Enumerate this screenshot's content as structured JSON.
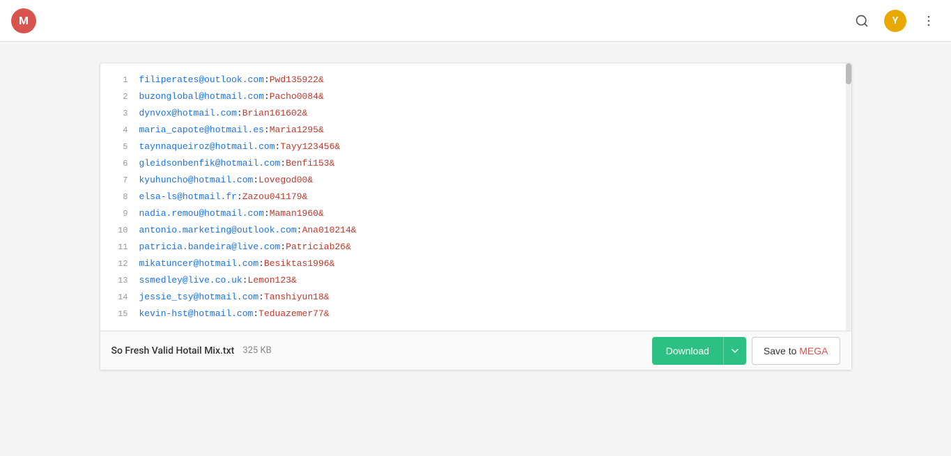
{
  "navbar": {
    "logo_letter": "M",
    "search_icon": "🔍",
    "user_initial": "Y",
    "more_icon": "⋮"
  },
  "file": {
    "name": "So Fresh Valid Hotail Mix.txt",
    "size": "325 KB",
    "download_label": "Download",
    "save_label": "Save to MEGA",
    "save_highlight": "MEGA"
  },
  "lines": [
    {
      "number": "1",
      "email": "filiperates@outlook.com",
      "password": "Pwd135922&"
    },
    {
      "number": "2",
      "email": "buzonglobal@hotmail.com",
      "password": "Pacho0084&"
    },
    {
      "number": "3",
      "email": "dynvox@hotmail.com",
      "password": "Brian161602&"
    },
    {
      "number": "4",
      "email": "maria_capote@hotmail.es",
      "password": "Maria1295&"
    },
    {
      "number": "5",
      "email": "taynnaqueiroz@hotmail.com",
      "password": "Tayy123456&"
    },
    {
      "number": "6",
      "email": "gleidsonbenfik@hotmail.com",
      "password": "Benfi153&"
    },
    {
      "number": "7",
      "email": "kyuhuncho@hotmail.com",
      "password": "Lovegod00&"
    },
    {
      "number": "8",
      "email": "elsa-ls@hotmail.fr",
      "password": "Zazou041179&"
    },
    {
      "number": "9",
      "email": "nadia.remou@hotmail.com",
      "password": "Maman1960&"
    },
    {
      "number": "10",
      "email": "antonio.marketing@outlook.com",
      "password": "Ana010214&"
    },
    {
      "number": "11",
      "email": "patricia.bandeira@live.com",
      "password": "Patriciab26&"
    },
    {
      "number": "12",
      "email": "mikatuncer@hotmail.com",
      "password": "Besiktas1996&"
    },
    {
      "number": "13",
      "email": "ssmedley@live.co.uk",
      "password": "Lemon123&"
    },
    {
      "number": "14",
      "email": "jessie_tsy@hotmail.com",
      "password": "Tanshiyun18&"
    },
    {
      "number": "15",
      "email": "kevin-hst@hotmail.com",
      "password": "Teduazemer77&"
    }
  ]
}
